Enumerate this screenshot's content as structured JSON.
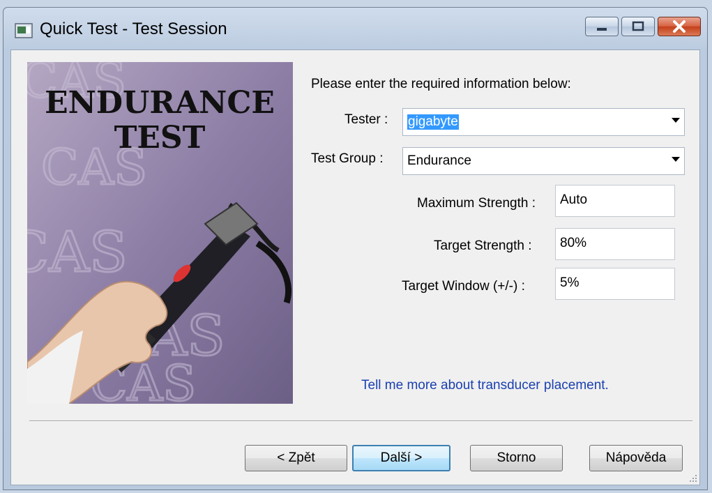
{
  "window": {
    "title": "Quick Test - Test Session",
    "icon": "app-window-icon",
    "controls": [
      "minimize-icon",
      "maximize-icon",
      "close-icon"
    ]
  },
  "banner": {
    "line1": "ENDURANCE",
    "line2": "TEST",
    "background_text": "CAS"
  },
  "form": {
    "instructions": "Please enter the required information below:",
    "tester": {
      "label": "Tester :",
      "value": "gigabyte"
    },
    "test_group": {
      "label": "Test Group :",
      "value": "Endurance"
    },
    "maximum_strength": {
      "label": "Maximum Strength :",
      "value": "Auto"
    },
    "target_strength": {
      "label": "Target Strength :",
      "value": "80%"
    },
    "target_window": {
      "label": "Target Window (+/-) :",
      "value": "5%"
    }
  },
  "link": {
    "text": "Tell me more about transducer placement."
  },
  "buttons": {
    "back": "< Zpět",
    "next": "Další >",
    "cancel": "Storno",
    "help": "Nápověda"
  }
}
